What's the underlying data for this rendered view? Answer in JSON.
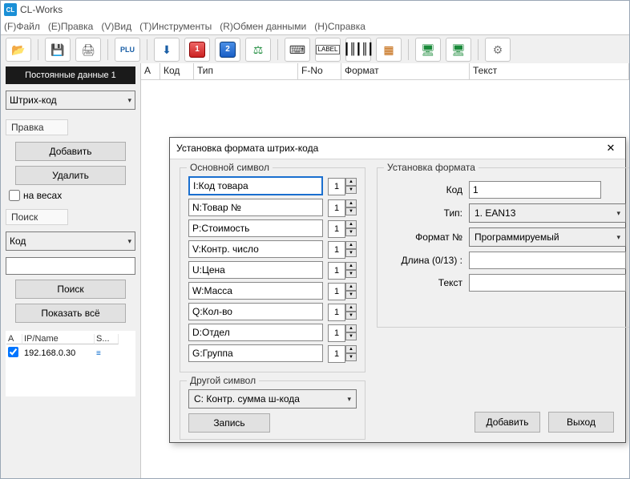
{
  "app": {
    "title": "CL-Works",
    "icon_label": "CL"
  },
  "menu": {
    "file": "(F)Файл",
    "edit": "(E)Правка",
    "view": "(V)Вид",
    "tools": "(T)Инструменты",
    "exchange": "(R)Обмен данными",
    "help": "(H)Справка"
  },
  "toolbar_nums": {
    "one": "1",
    "two": "2"
  },
  "sidebar": {
    "tab": "Постоянные данные 1",
    "type_select": "Штрих-код",
    "sections": {
      "edit": "Правка",
      "search": "Поиск"
    },
    "buttons": {
      "add": "Добавить",
      "delete": "Удалить",
      "search": "Поиск",
      "show_all": "Показать всё"
    },
    "checkbox_label": "на весах",
    "search_by": "Код",
    "ip_headers": {
      "a": "A",
      "ip": "IP/Name",
      "s": "S..."
    },
    "ip_row": {
      "ip": "192.168.0.30"
    }
  },
  "grid": {
    "cols": {
      "a": "A",
      "code": "Код",
      "type": "Тип",
      "fno": "F-No",
      "format": "Формат",
      "text": "Текст"
    }
  },
  "dialog": {
    "title": "Установка формата штрих-кода",
    "group_main": "Основной символ",
    "group_other": "Другой символ",
    "group_format": "Установка формата",
    "symbols": [
      {
        "label": "I:Код товара",
        "val": "1",
        "highlight": true
      },
      {
        "label": "N:Товар №",
        "val": "1"
      },
      {
        "label": "P:Стоимость",
        "val": "1"
      },
      {
        "label": "V:Контр. число",
        "val": "1"
      },
      {
        "label": "U:Цена",
        "val": "1"
      },
      {
        "label": "W:Масса",
        "val": "1"
      },
      {
        "label": "Q:Кол-во",
        "val": "1"
      },
      {
        "label": "D:Отдел",
        "val": "1"
      },
      {
        "label": "G:Группа",
        "val": "1"
      }
    ],
    "other_select": "C: Контр. сумма ш-кода",
    "other_btn": "Запись",
    "fmt": {
      "code_label": "Код",
      "code_val": "1",
      "type_label": "Тип:",
      "type_val": "1. EAN13",
      "fno_label": "Формат №",
      "fno_val": "Программируемый",
      "len_label": "Длина (0/13) :",
      "len_val": "",
      "text_label": "Текст",
      "text_val": ""
    },
    "buttons": {
      "add": "Добавить",
      "exit": "Выход"
    }
  }
}
